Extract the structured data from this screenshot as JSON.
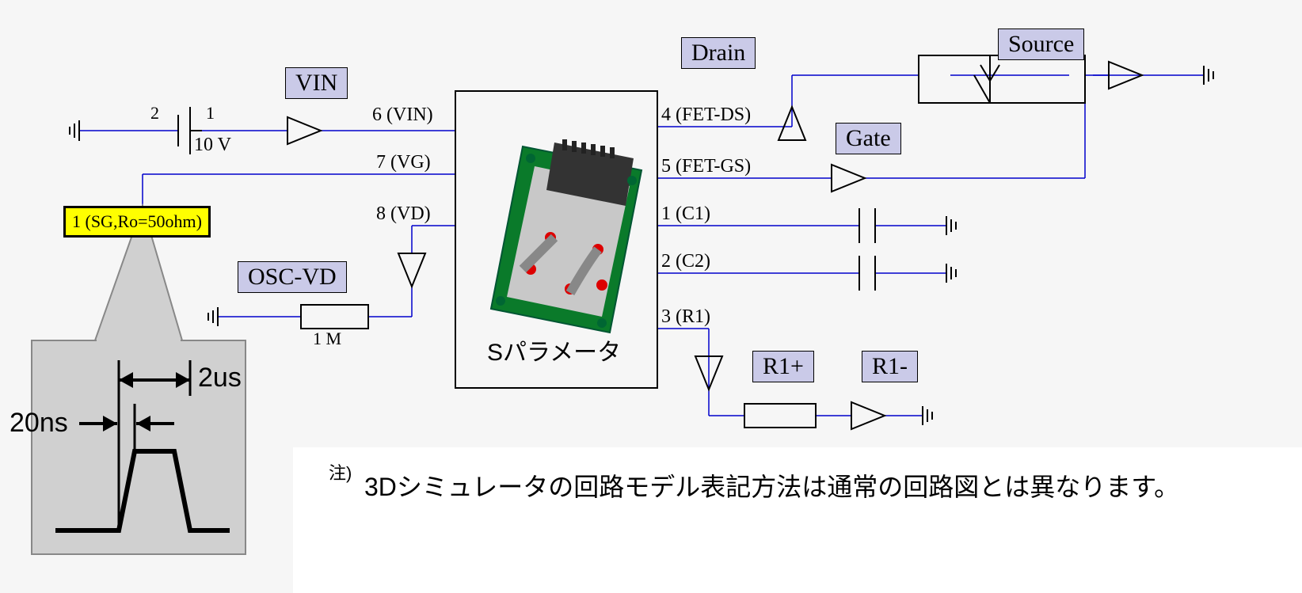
{
  "labels": {
    "vin": "VIN",
    "osc_vd": "OSC-VD",
    "drain": "Drain",
    "gate": "Gate",
    "source": "Source",
    "r1p": "R1+",
    "r1m": "R1-"
  },
  "ports": {
    "p6": "6 (VIN)",
    "p7": "7 (VG)",
    "p8": "8 (VD)",
    "p4": "4 (FET-DS)",
    "p5": "5 (FET-GS)",
    "p1": "1 (C1)",
    "p2": "2 (C2)",
    "p3": "3 (R1)"
  },
  "voltage_source": {
    "node2": "2",
    "node1": "1",
    "value": "10 V"
  },
  "resistor_osc": "1 M",
  "sg_box": "1 (SG,Ro=50ohm)",
  "sparam_label": "Sパラメータ",
  "pulse": {
    "width": "2us",
    "rise": "20ns"
  },
  "footnote_sup": "注)",
  "footnote": "3Dシミュレータの回路モデル表記方法は通常の回路図とは異なります。"
}
